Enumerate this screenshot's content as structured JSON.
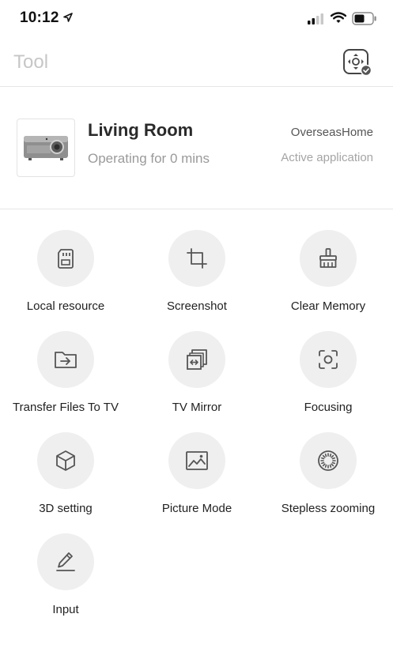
{
  "status_bar": {
    "time": "10:12",
    "icons": [
      "location-arrow-icon",
      "signal-icon",
      "wifi-icon",
      "battery-icon"
    ]
  },
  "nav": {
    "title": "Tool",
    "action_icon": "remote-control-icon"
  },
  "device": {
    "name": "Living Room",
    "status": "Operating for 0 mins",
    "network": "OverseasHome",
    "app_status": "Active application",
    "thumbnail_icon": "projector-icon"
  },
  "tools": [
    {
      "label": "Local resource",
      "icon": "sd-card-icon"
    },
    {
      "label": "Screenshot",
      "icon": "crop-icon"
    },
    {
      "label": "Clear Memory",
      "icon": "broom-icon"
    },
    {
      "label": "Transfer Files To TV",
      "icon": "folder-transfer-icon"
    },
    {
      "label": "TV Mirror",
      "icon": "mirror-icon"
    },
    {
      "label": "Focusing",
      "icon": "focus-icon"
    },
    {
      "label": "3D setting",
      "icon": "cube-icon"
    },
    {
      "label": "Picture Mode",
      "icon": "picture-icon"
    },
    {
      "label": "Stepless zooming",
      "icon": "zoom-dial-icon"
    },
    {
      "label": "Input",
      "icon": "pen-icon"
    }
  ],
  "colors": {
    "background": "#ffffff",
    "circle": "#efefef",
    "divider": "#e6e6e6",
    "title_muted": "#c6c6c6",
    "icon_stroke": "#555555"
  }
}
